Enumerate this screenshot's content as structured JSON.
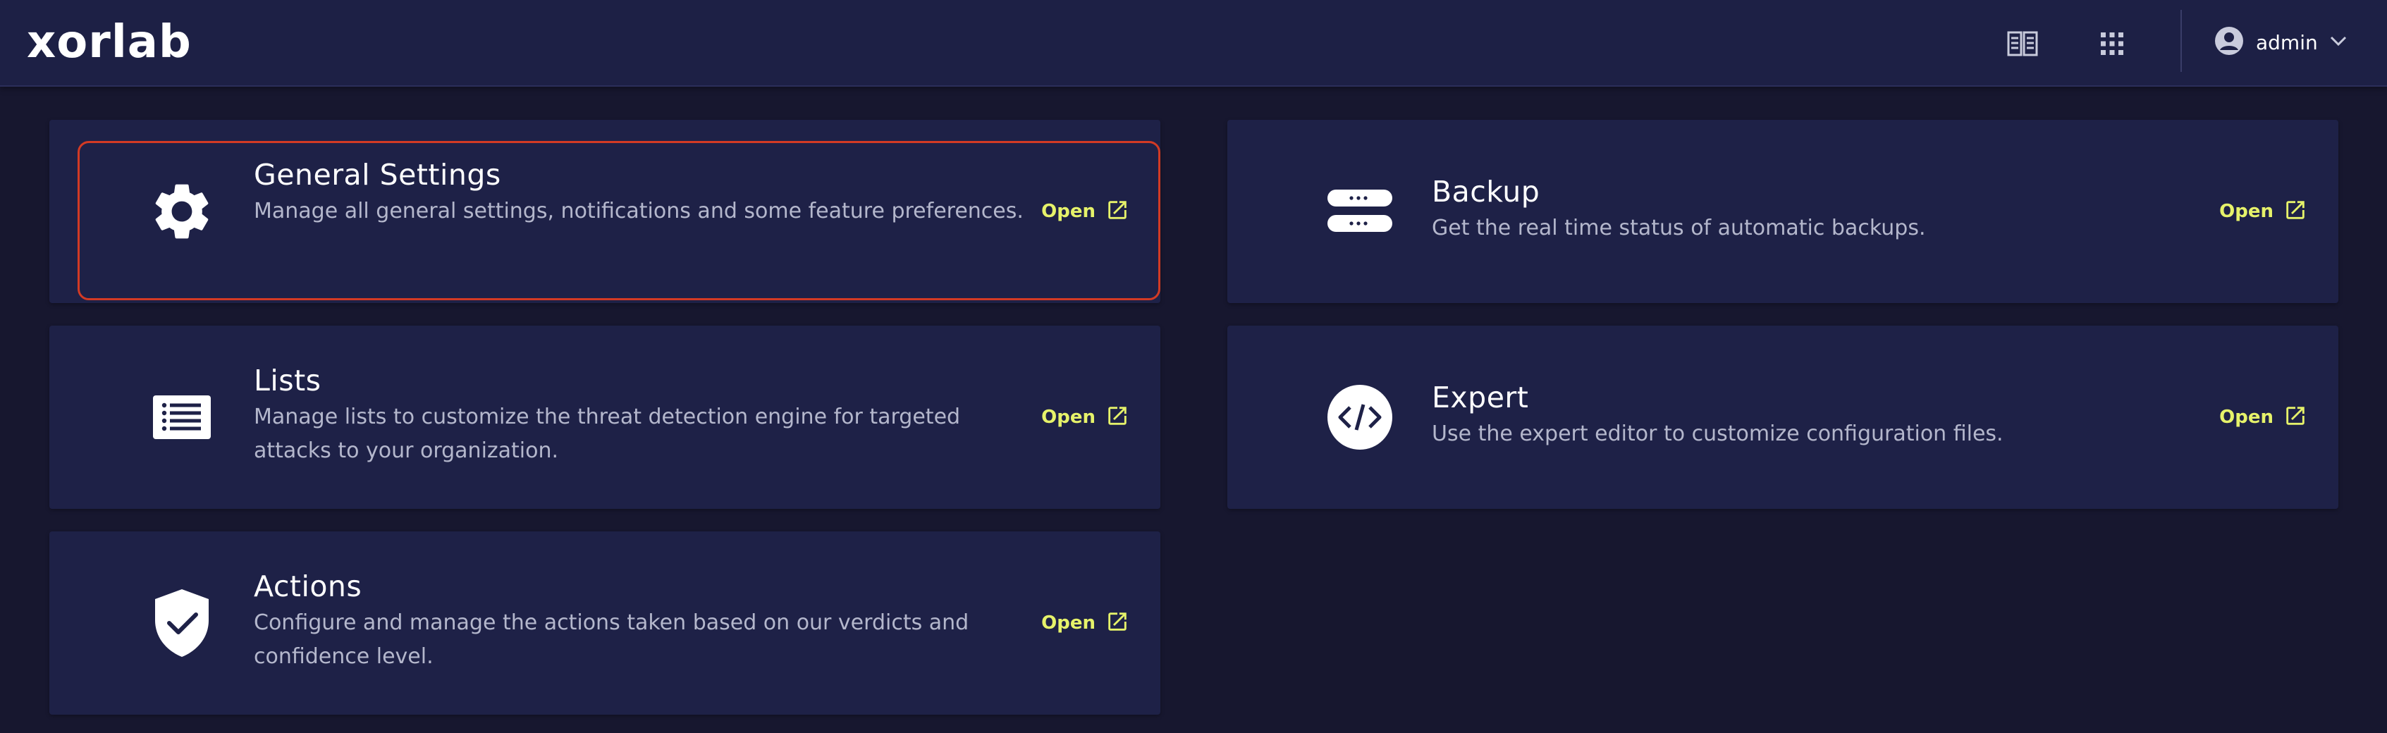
{
  "header": {
    "logo_text": "xorlab",
    "icons": [
      "book-icon",
      "apps-grid-icon"
    ],
    "user": {
      "name": "admin",
      "avatar_icon": "account-circle-icon",
      "menu_icon": "chevron-down-icon"
    }
  },
  "cards": [
    {
      "id": "general-settings",
      "title": "General Settings",
      "description": "Manage all general settings, notifications and some feature preferences.",
      "icon": "gear-icon",
      "open_label": "Open",
      "focused": true
    },
    {
      "id": "backup",
      "title": "Backup",
      "description": "Get the real time status of automatic backups.",
      "icon": "server-icon",
      "open_label": "Open"
    },
    {
      "id": "lists",
      "title": "Lists",
      "description": "Manage lists to customize the threat detection engine for targeted attacks to your organization.",
      "icon": "list-icon",
      "open_label": "Open"
    },
    {
      "id": "expert",
      "title": "Expert",
      "description": "Use the expert editor to customize configuration files.",
      "icon": "code-icon",
      "open_label": "Open"
    },
    {
      "id": "actions",
      "title": "Actions",
      "description": "Configure and manage the actions taken based on our verdicts and confidence level.",
      "icon": "shield-check-icon",
      "open_label": "Open"
    }
  ],
  "colors": {
    "background": "#17172f",
    "header": "#1d2045",
    "card": "#1e2147",
    "accent_link": "#e6f26a",
    "focus_ring": "#d33a24",
    "text_secondary": "#b4b7cc"
  }
}
